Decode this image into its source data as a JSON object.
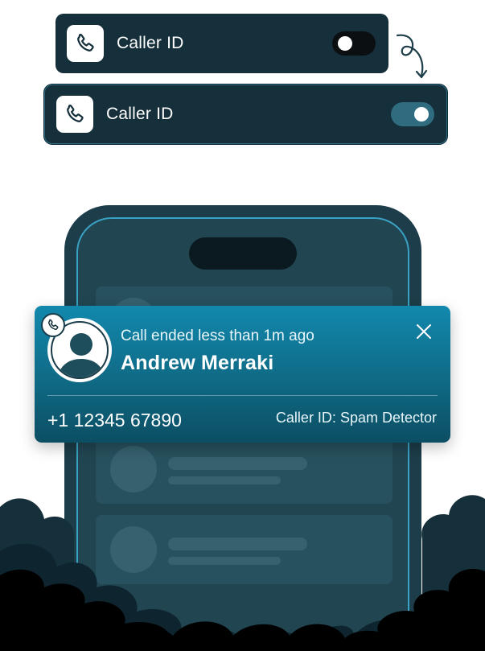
{
  "toggle_cards": [
    {
      "label": "Caller ID",
      "state": "off"
    },
    {
      "label": "Caller ID",
      "state": "on"
    }
  ],
  "notification": {
    "subtitle": "Call ended less than 1m ago",
    "caller_name": "Andrew Merraki",
    "phone_number": "+1 12345 67890",
    "source": "Caller ID: Spam Detector"
  },
  "icons": {
    "app_icon": "phone-icon",
    "badge_icon": "phone-icon",
    "close": "close-icon",
    "avatar": "user-avatar-icon",
    "arrow": "curly-arrow-icon"
  },
  "colors": {
    "card_bg": "#16303b",
    "accent": "#1288ad",
    "switch_on": "#2f6c80",
    "phone_body": "#1c3d49"
  }
}
